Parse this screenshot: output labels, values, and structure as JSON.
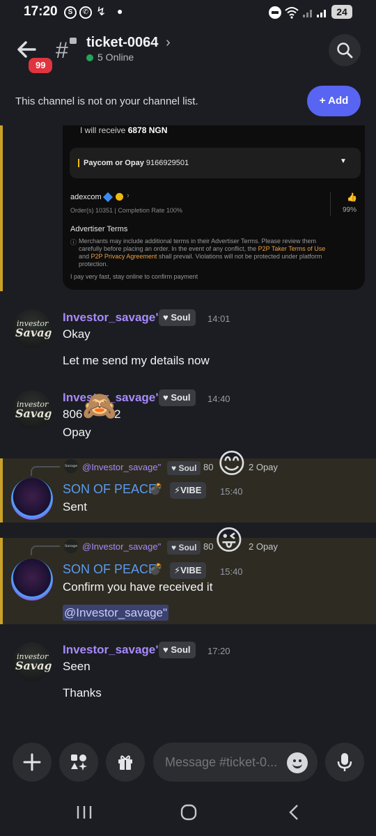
{
  "status_bar": {
    "time": "17:20",
    "battery": "24",
    "icons": [
      "s-icon",
      "whatsapp-icon",
      "missed-call-icon",
      "dot-icon",
      "do-not-disturb-icon",
      "wifi-icon",
      "signal-icon",
      "signal-icon"
    ]
  },
  "header": {
    "unread_count": "99",
    "channel_name": "ticket-0064",
    "online_text": "5 Online",
    "online_color": "#23a55a"
  },
  "notice": {
    "text": "This channel is not on your channel list.",
    "add_label": "+ Add",
    "accent": "#5865f2"
  },
  "embedded_image": {
    "receive_label": "I will receive",
    "receive_amount": "6878 NGN",
    "payment_method": "Paycom or Opay",
    "payment_number": "9166929501",
    "merchant": "adexcom",
    "orders": "Order(s) 10351",
    "completion": "Completion Rate 100%",
    "rating": "99%",
    "terms_title": "Advertiser Terms",
    "terms_line1": "Merchants may include additional terms in their Advertiser Terms. Please review them",
    "terms_line2_pre": "carefully before placing an order. In the event of any conflict, the",
    "terms_link1": "P2P Taker Terms of Use",
    "terms_line3_pre": "and",
    "terms_link2": "P2P Privacy Agreement",
    "terms_line3_post": "shall prevail. Violations will not be protected under platform",
    "terms_line4": "protection.",
    "footer": "I pay very fast, stay online to confirm payment"
  },
  "messages": [
    {
      "author": "Investor_savage\"",
      "tag": "Soul",
      "time": "14:01",
      "lines": [
        "Okay",
        "Let me send my details now"
      ]
    },
    {
      "author": "Investor_savage\"",
      "tag": "Soul",
      "time": "14:40",
      "lines": [
        "806",
        "2",
        "Opay"
      ]
    },
    {
      "reply_to": "@Investor_savage\"",
      "reply_tag": "Soul",
      "reply_text_a": "80",
      "reply_text_b": "2 Opay",
      "author": "SON OF PEACE",
      "tag": "VIBE",
      "time": "15:40",
      "lines": [
        "Sent"
      ]
    },
    {
      "reply_to": "@Investor_savage\"",
      "reply_tag": "Soul",
      "reply_text_a": "80",
      "reply_text_b": "2 Opay",
      "author": "SON OF PEACE",
      "tag": "VIBE",
      "time": "15:40",
      "lines": [
        "Confirm you have received it"
      ],
      "mention": "@Investor_savage\""
    },
    {
      "author": "Investor_savage\"",
      "tag": "Soul",
      "time": "17:20",
      "lines": [
        "Seen",
        "Thanks"
      ]
    }
  ],
  "composer": {
    "placeholder": "Message #ticket-0..."
  },
  "avatar_text": {
    "top": "investor",
    "bottom": "Savage"
  }
}
